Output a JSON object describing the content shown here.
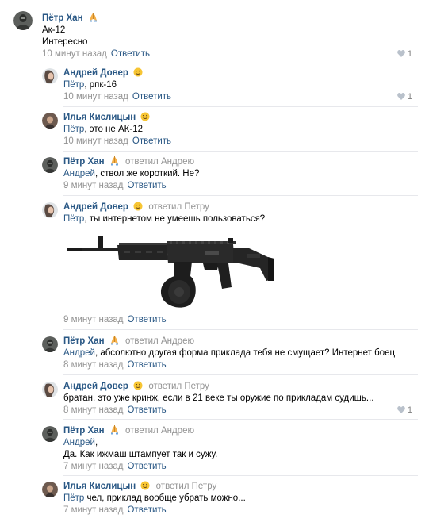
{
  "comments": [
    {
      "author": "Пётр Хан",
      "emoji": "pray-hands-emoji",
      "reply_to": "",
      "lines": [
        "Ак-12",
        "Интересно"
      ],
      "mention": "",
      "time": "10 минут назад",
      "reply_label": "Ответить",
      "likes": "1"
    },
    {
      "author": "Андрей Довер",
      "emoji": "winking-face-emoji",
      "reply_to": "",
      "mention": "Пётр",
      "text": ", рпк-16",
      "time": "10 минут назад",
      "reply_label": "Ответить",
      "likes": "1"
    },
    {
      "author": "Илья Кислицын",
      "emoji": "winking-face-emoji",
      "reply_to": "",
      "mention": "Пётр",
      "text": ", это не АК-12",
      "time": "10 минут назад",
      "reply_label": "Ответить",
      "likes": ""
    },
    {
      "author": "Пётр Хан",
      "emoji": "pray-hands-emoji",
      "reply_to": "ответил Андрею",
      "mention": "Андрей",
      "text": ", ствол же короткий. Не?",
      "time": "9 минут назад",
      "reply_label": "Ответить",
      "likes": ""
    },
    {
      "author": "Андрей Довер",
      "emoji": "winking-face-emoji",
      "reply_to": "ответил Петру",
      "mention": "Пётр",
      "text": ", ты интернетом не умеешь пользоваться?",
      "attachment": "rifle-photo",
      "time": "9 минут назад",
      "reply_label": "Ответить",
      "likes": ""
    },
    {
      "author": "Пётр Хан",
      "emoji": "pray-hands-emoji",
      "reply_to": "ответил Андрею",
      "mention": "Андрей",
      "text": ", абсолютно другая форма приклада тебя не смущает? Интернет боец",
      "time": "8 минут назад",
      "reply_label": "Ответить",
      "likes": ""
    },
    {
      "author": "Андрей Довер",
      "emoji": "winking-face-emoji",
      "reply_to": "ответил Петру",
      "mention": "",
      "text": "братан, это уже кринж, если в 21 веке ты оружие по прикладам судишь...",
      "time": "8 минут назад",
      "reply_label": "Ответить",
      "likes": "1"
    },
    {
      "author": "Пётр Хан",
      "emoji": "pray-hands-emoji",
      "reply_to": "ответил Андрею",
      "mention": "Андрей",
      "text": ",",
      "text2": "Да. Как ижмаш штампует так и сужу.",
      "time": "7 минут назад",
      "reply_label": "Ответить",
      "likes": ""
    },
    {
      "author": "Илья Кислицын",
      "emoji": "winking-face-emoji",
      "reply_to": "ответил Петру",
      "mention": "Пётр",
      "text": " чел, приклад вообще убрать можно...",
      "time": "7 минут назад",
      "reply_label": "Ответить",
      "likes": ""
    }
  ],
  "colors": {
    "link": "#2a5885",
    "meta": "#939393",
    "divider": "#e7e8ec"
  }
}
